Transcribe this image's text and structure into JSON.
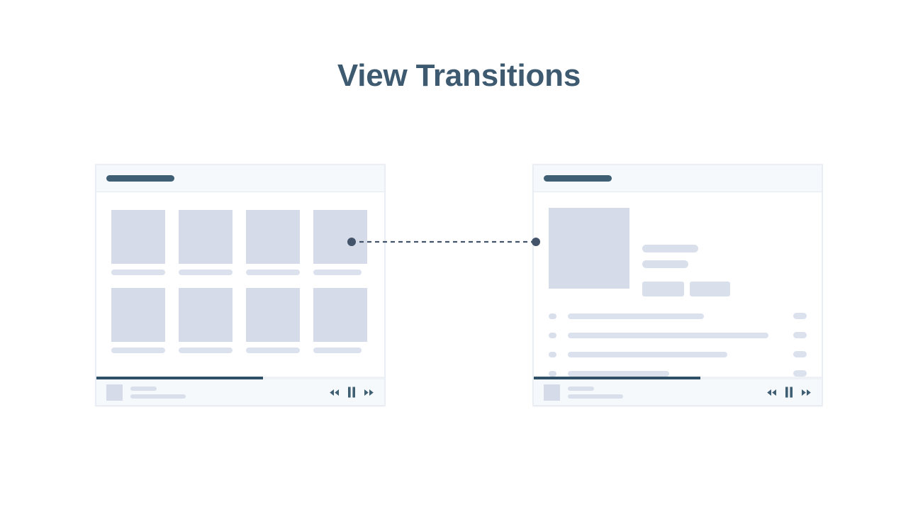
{
  "page": {
    "title": "View Transitions",
    "background": "#ffffff",
    "title_color": "#3d5a70"
  },
  "theme": {
    "placeholder": "#d6dbe9",
    "placeholder_light": "#dbe1ed",
    "panel_header_bg": "#f6f9fc",
    "accent_dark": "#3f5f74",
    "progress_fill": "#2f5066",
    "connector": "#44546a"
  },
  "panels": [
    {
      "name": "grid-view",
      "header": {
        "title_placeholder": true
      },
      "cards": [
        {
          "caption_width": "w-full"
        },
        {
          "caption_width": "w-full"
        },
        {
          "caption_width": "w-full"
        },
        {
          "caption_width": "w-short"
        },
        {
          "caption_width": "w-full"
        },
        {
          "caption_width": "w-full"
        },
        {
          "caption_width": "w-full"
        },
        {
          "caption_width": "w-short"
        }
      ],
      "player": {
        "progress_percent": 58,
        "controls": [
          "rewind-icon",
          "pause-icon",
          "fast-forward-icon"
        ]
      }
    },
    {
      "name": "detail-view",
      "header": {
        "title_placeholder": true
      },
      "hero": {
        "has_image": true
      },
      "meta_lines": 2,
      "buttons": 2,
      "list_rows": [
        {
          "line_width": "r1"
        },
        {
          "line_width": "r2"
        },
        {
          "line_width": "r3"
        },
        {
          "line_width": "r4"
        }
      ],
      "player": {
        "progress_percent": 58,
        "controls": [
          "rewind-icon",
          "pause-icon",
          "fast-forward-icon"
        ]
      }
    }
  ],
  "connector": {
    "style": "dashed",
    "from": "grid-card-4",
    "to": "detail-hero",
    "endpoint_radius": 6
  }
}
